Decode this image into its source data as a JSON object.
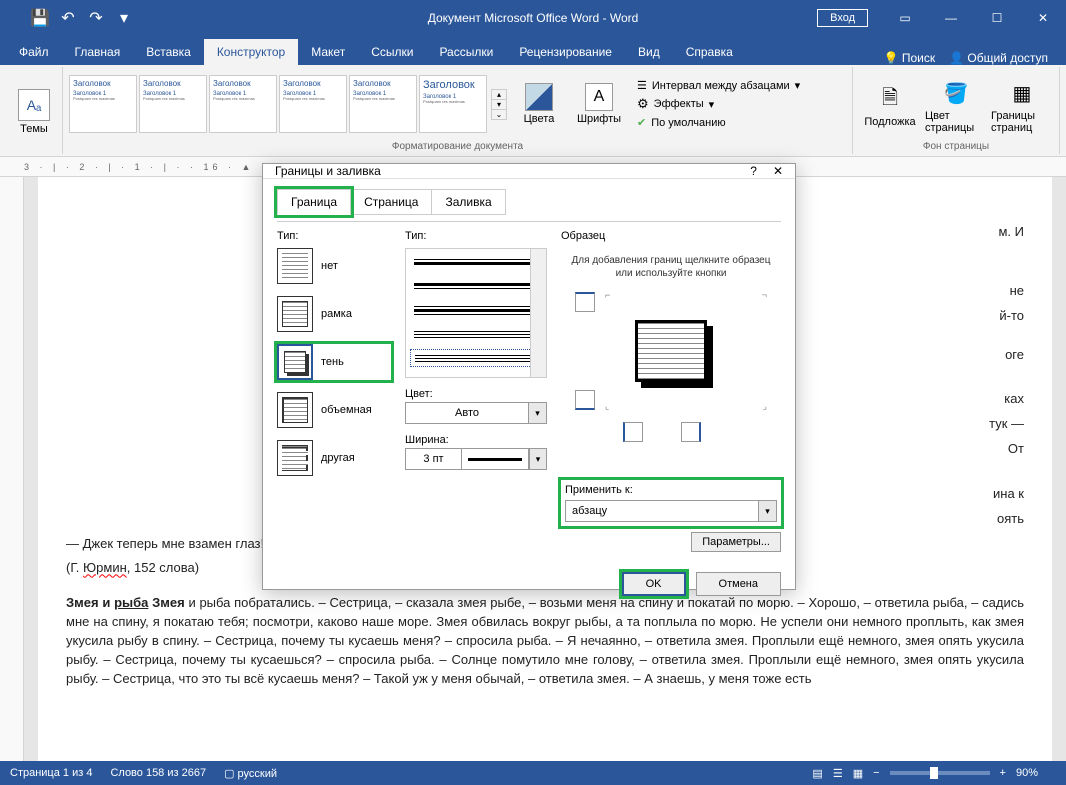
{
  "titlebar": {
    "title": "Документ Microsoft Office Word  -  Word",
    "signin": "Вход"
  },
  "tabs": {
    "file": "Файл",
    "home": "Главная",
    "insert": "Вставка",
    "design": "Конструктор",
    "layout": "Макет",
    "references": "Ссылки",
    "mailings": "Рассылки",
    "review": "Рецензирование",
    "view": "Вид",
    "help": "Справка",
    "search": "Поиск",
    "share": "Общий доступ"
  },
  "ribbon": {
    "themes": "Темы",
    "style_title": "Заголовок",
    "style_sub": "Заголовок 1",
    "colors": "Цвета",
    "fonts": "Шрифты",
    "paragraph_spacing": "Интервал между абзацами",
    "effects": "Эффекты",
    "default": "По умолчанию",
    "watermark": "Подложка",
    "page_color": "Цвет страницы",
    "page_borders": "Границы страниц",
    "page_bg_group": "Фон страницы",
    "doc_format": "Форматирование документа"
  },
  "ruler": "3 · | · 2 · | · 1 · | ·                                                                                                              · 16 · ▲ · 17 · | ·",
  "dialog": {
    "title": "Границы и заливка",
    "tab_border": "Граница",
    "tab_page": "Страница",
    "tab_fill": "Заливка",
    "type": "Тип:",
    "type_none": "нет",
    "type_box": "рамка",
    "type_shadow": "тень",
    "type_3d": "объемная",
    "type_custom": "другая",
    "style": "Тип:",
    "color": "Цвет:",
    "color_auto": "Авто",
    "width": "Ширина:",
    "width_val": "3 пт",
    "preview": "Образец",
    "preview_hint": "Для добавления границ щелкните образец или используйте кнопки",
    "apply_to": "Применить к:",
    "apply_val": "абзацу",
    "params": "Параметры...",
    "ok": "OK",
    "cancel": "Отмена"
  },
  "document": {
    "p1_suffix": "м. И",
    "p2a": "не",
    "p2b": "й-то",
    "p3": "оге",
    "p4a": "ках",
    "p4b": "тук —",
    "p4c": "От",
    "p5a": "ина к",
    "p5b": "оять",
    "p6": "— Джек теперь мне взамен глаз! — не хвалится своим поводырем бывший летчик.",
    "p7": "(Г. Юрмин, 152 слова)",
    "p8_title": "Змея и рыба Змея",
    "p8": " и рыба побратались. – Сестрица, – сказала змея рыбе, – возьми меня на спину и покатай по морю. – Хорошо, – ответила рыба, – садись мне на спину, я покатаю тебя; посмотри, каково наше море. Змея обвилась вокруг рыбы, а та поплыла по морю. Не успели они немного проплыть, как змея укусила рыбу в спину. – Сестрица, почему ты кусаешь меня? – спросила рыба.    – Я нечаянно, – ответила змея. Проплыли ещё немного, змея опять укусила рыбу. – Сестрица, почему ты кусаешься? – спросила рыба. – Солнце помутило мне голову, – ответила змея. Проплыли ещё немного, змея опять укусила рыбу. – Сестрица, что это ты всё кусаешь меня? – Такой уж у меня обычай, – ответила змея. – А знаешь, у меня тоже есть"
  },
  "status": {
    "page": "Страница 1 из 4",
    "words": "Слово 158 из 2667",
    "lang": "русский",
    "zoom": "90%"
  }
}
